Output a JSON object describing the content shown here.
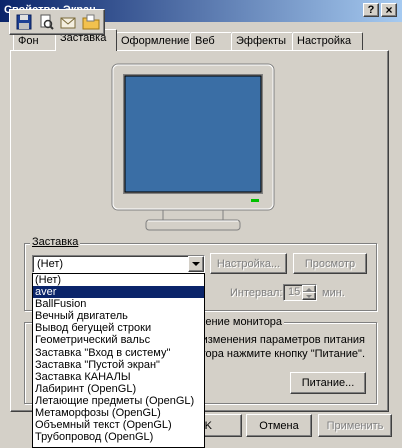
{
  "window": {
    "title": "Свойства: Экран",
    "help_label": "?",
    "close_label": "×"
  },
  "tabs": [
    {
      "label": "Фон"
    },
    {
      "label": "Заставка"
    },
    {
      "label": "Оформление"
    },
    {
      "label": "Веб"
    },
    {
      "label": "Эффекты"
    },
    {
      "label": "Настройка"
    }
  ],
  "screensaver": {
    "group_label": "Заставка",
    "selected": "(Нет)",
    "settings_button": "Настройка...",
    "preview_button": "Просмотр",
    "interval_label": "Интервал:",
    "interval_value": "15",
    "interval_unit": "мин.",
    "dropdown_items": [
      "(Нет)",
      "aver",
      "BallFusion",
      "Вечный двигатель",
      "Вывод бегущей строки",
      "Геометрический вальс",
      "Заставка \"Вход в систему\"",
      "Заставка \"Пустой экран\"",
      "Заставка КАНАЛЫ",
      "Лабиринт (OpenGL)",
      "Летающие предметы (OpenGL)",
      "Метаморфозы (OpenGL)",
      "Объемный текст (OpenGL)",
      "Трубопровод (OpenGL)"
    ],
    "highlighted_index": 1
  },
  "power": {
    "group_label": "Энергосбережение монитора",
    "text_line1": "Для изменения параметров питания",
    "text_line2": "монитора нажмите кнопку \"Питание\".",
    "button": "Питание..."
  },
  "footer": {
    "ok": "OK",
    "cancel": "Отмена",
    "apply": "Применить"
  },
  "colors": {
    "face": "#d4d0c8",
    "monitor_screen": "#3a6ea5",
    "selection": "#0a246a"
  }
}
